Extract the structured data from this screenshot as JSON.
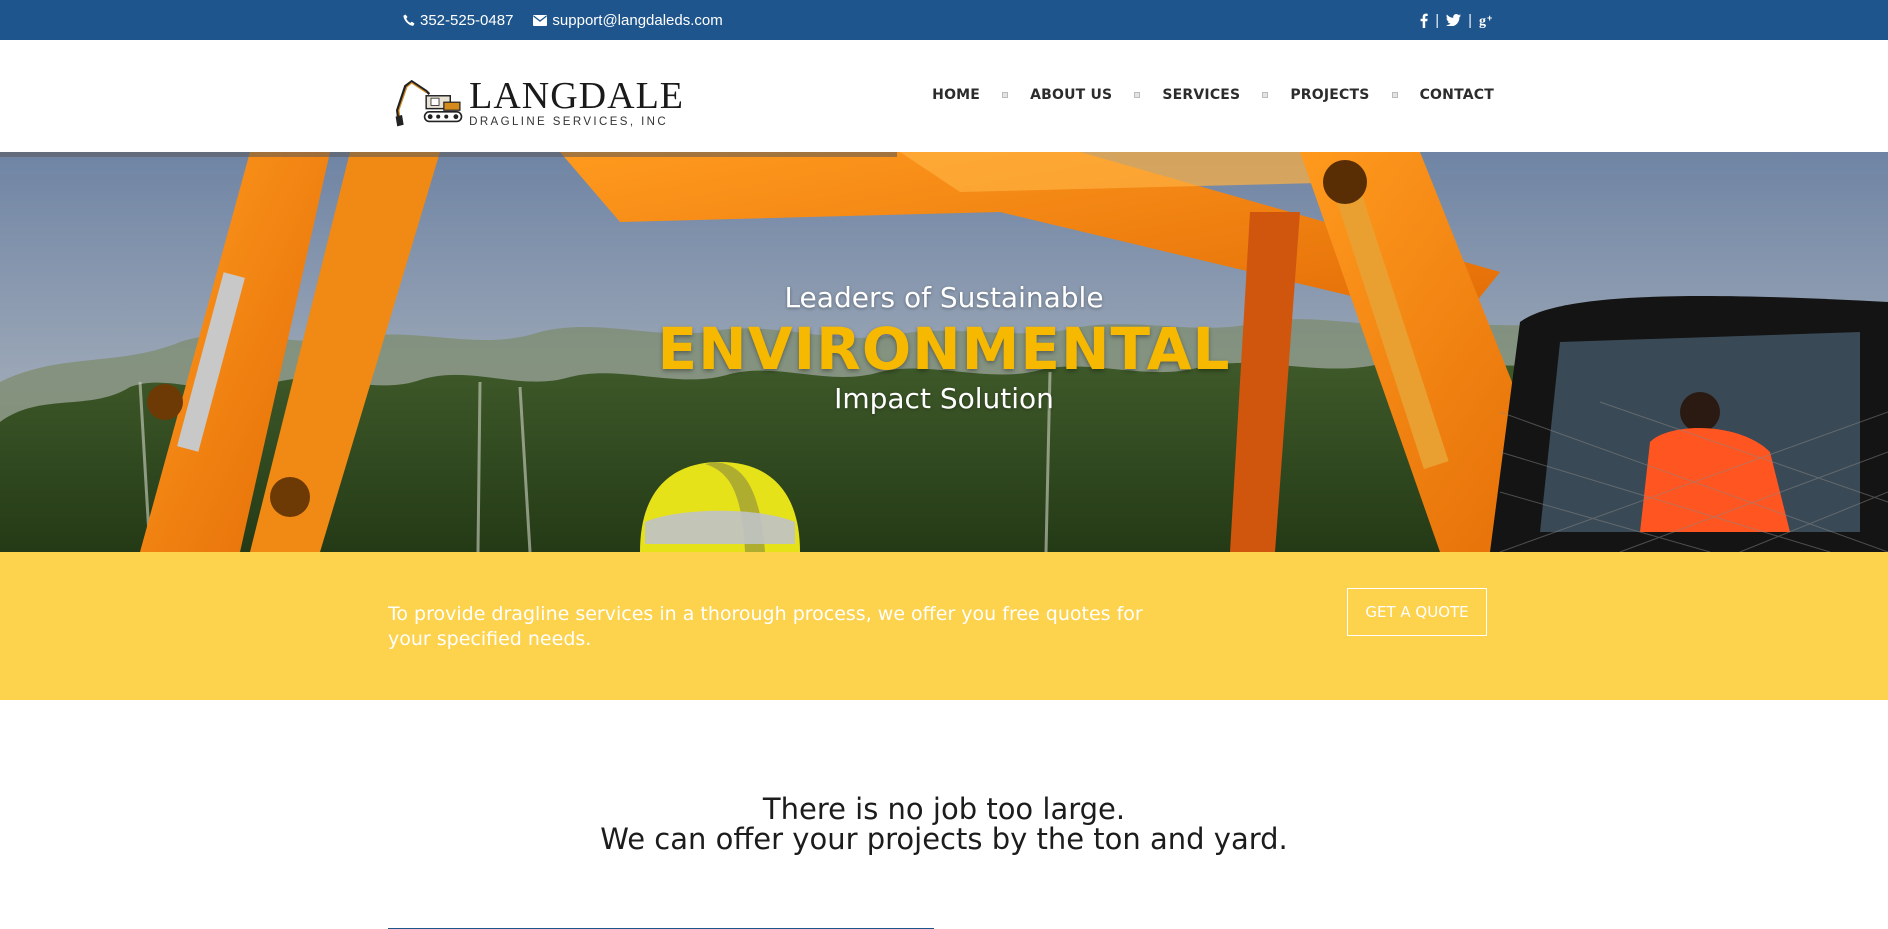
{
  "topbar": {
    "phone": "352-525-0487",
    "email": "support@langdaleds.com",
    "social": [
      "facebook-icon",
      "twitter-icon",
      "google-plus-icon"
    ],
    "separator": "|",
    "bg_color": "#1d558c"
  },
  "logo": {
    "name": "LANGDALE",
    "subtitle": "DRAGLINE SERVICES, INC"
  },
  "nav": {
    "items": [
      {
        "label": "HOME"
      },
      {
        "label": "ABOUT US"
      },
      {
        "label": "SERVICES"
      },
      {
        "label": "PROJECTS"
      },
      {
        "label": "CONTACT"
      }
    ]
  },
  "hero": {
    "line1": "Leaders of Sustainable",
    "headline": "ENVIRONMENTAL",
    "line3": "Impact Solution",
    "headline_color": "#f6b900"
  },
  "band": {
    "text": "To provide dragline services in a thorough process, we offer you free quotes for your specified needs.",
    "button_label": "GET A QUOTE",
    "bg_color": "#fdd24c"
  },
  "tagline": {
    "line1": "There is no job too large.",
    "line2": "We can offer your projects by the ton and yard."
  }
}
